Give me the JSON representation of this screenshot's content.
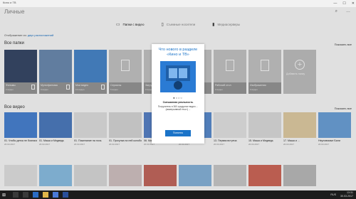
{
  "window": {
    "title": "Кино и ТВ"
  },
  "header": {
    "title": "Личные"
  },
  "tabs": [
    {
      "label": "Папки с видео",
      "icon": "folder-icon"
    },
    {
      "label": "Съемные носители",
      "icon": "usb-drive-icon"
    },
    {
      "label": "Медиасерверы",
      "icon": "media-server-icon"
    }
  ],
  "source_line": {
    "text": "Отображение из:",
    "link": "двух расположений"
  },
  "folders_section": {
    "title": "Все папки",
    "show_all": "Показать все",
    "items": [
      {
        "name": "Фильмы",
        "count": "2 видео",
        "thumb_color": "#3a4a6a"
      },
      {
        "name": "Мультфильмы",
        "count": "9 видео",
        "thumb_color": "#6f8fb5"
      },
      {
        "name": "Мои видео",
        "count": "13 видео",
        "thumb_color": "#4b8ad0"
      },
      {
        "name": "Сериалы",
        "count": "5 видео",
        "thumb_color": "#c9c9c9"
      },
      {
        "name": "Загрузки",
        "count": "0 видео",
        "thumb_color": "#c9c9c9"
      },
      {
        "name": "Документы",
        "count": "0 видео",
        "thumb_color": "#c9c9c9"
      },
      {
        "name": "Рабочий стол",
        "count": "0 видео",
        "thumb_color": "#c9c9c9"
      },
      {
        "name": "Изображения",
        "count": "0 видео",
        "thumb_color": "#c9c9c9"
      }
    ],
    "add_label": "Добавить папку"
  },
  "videos_section": {
    "title": "Все видео",
    "show_all": "Показать все",
    "items": [
      {
        "name": "01. Чтобы детка не боялась...",
        "date": "20.03.2017",
        "thumb_color": "#4a86d8"
      },
      {
        "name": "01. Маша и Медведь",
        "date": "20.03.2017",
        "thumb_color": "#4f7fc4"
      },
      {
        "name": "01. Пожелание на ночь",
        "date": "20.03.2017",
        "thumb_color": "#e5e5e5"
      },
      {
        "name": "01. Прогулка на ней колобок",
        "date": "20.03.2017",
        "thumb_color": "#dcdcdc"
      },
      {
        "name": "06. Маша и Медведь",
        "date": "20.03.2017",
        "thumb_color": "#5a86cc"
      },
      {
        "name": "08. Как растут грибы",
        "date": "20.03.2017",
        "thumb_color": "#5d90d4"
      },
      {
        "name": "13. Первая встреча",
        "date": "20.03.2017",
        "thumb_color": "#eaeaea"
      },
      {
        "name": "15. Маша и Медведь",
        "date": "20.03.2017",
        "thumb_color": "#e2e2e2"
      },
      {
        "name": "17. Маша и ...",
        "date": "20.03.2017",
        "thumb_color": "#e6d2a8"
      },
      {
        "name": "Неуловимые Бали",
        "date": "20.03.2017",
        "thumb_color": "#6fa6de"
      },
      {
        "name": "сопотов",
        "date": "20.03.2017",
        "thumb_color": "#ececec"
      }
    ]
  },
  "video_row2_colors": [
    "#e8e8e8",
    "#8fc4ea",
    "#e0e0e0",
    "#d8c8c8",
    "#c96a60",
    "#8ab8e0",
    "#cfcfcf",
    "#d46a5c",
    "#c0c0c0"
  ],
  "dialog": {
    "title": "Что нового в разделе «Кино и ТВ»",
    "dots": "●○○○",
    "heading": "Смешанная реальность",
    "body": "Погрузитесь в 360-градусное видео ... (иммерсивный текст) ...",
    "ok": "Понятно"
  },
  "taskbar": {
    "language": "RUS",
    "time": "13:31",
    "date": "30.03.2017"
  }
}
